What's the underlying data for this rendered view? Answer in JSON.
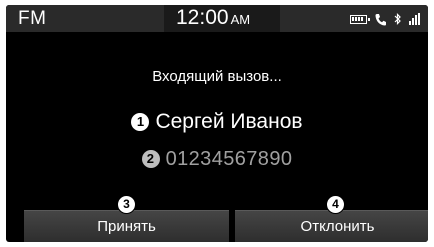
{
  "status_bar": {
    "source": "FM",
    "time": "12:00",
    "ampm": "AM",
    "icons": [
      "battery-icon",
      "phone-icon",
      "bluetooth-icon",
      "signal-icon"
    ]
  },
  "call": {
    "status": "Входящий вызов...",
    "caller_marker": "1",
    "caller_name": "Сергей Иванов",
    "number_marker": "2",
    "number": "01234567890"
  },
  "actions": {
    "accept_marker": "3",
    "accept_label": "Принять",
    "decline_marker": "4",
    "decline_label": "Отклонить"
  },
  "colors": {
    "background": "#000000",
    "status_bar": "#2a2a2a",
    "number_text": "#a0a0a0",
    "button": "#3a3a3a"
  }
}
